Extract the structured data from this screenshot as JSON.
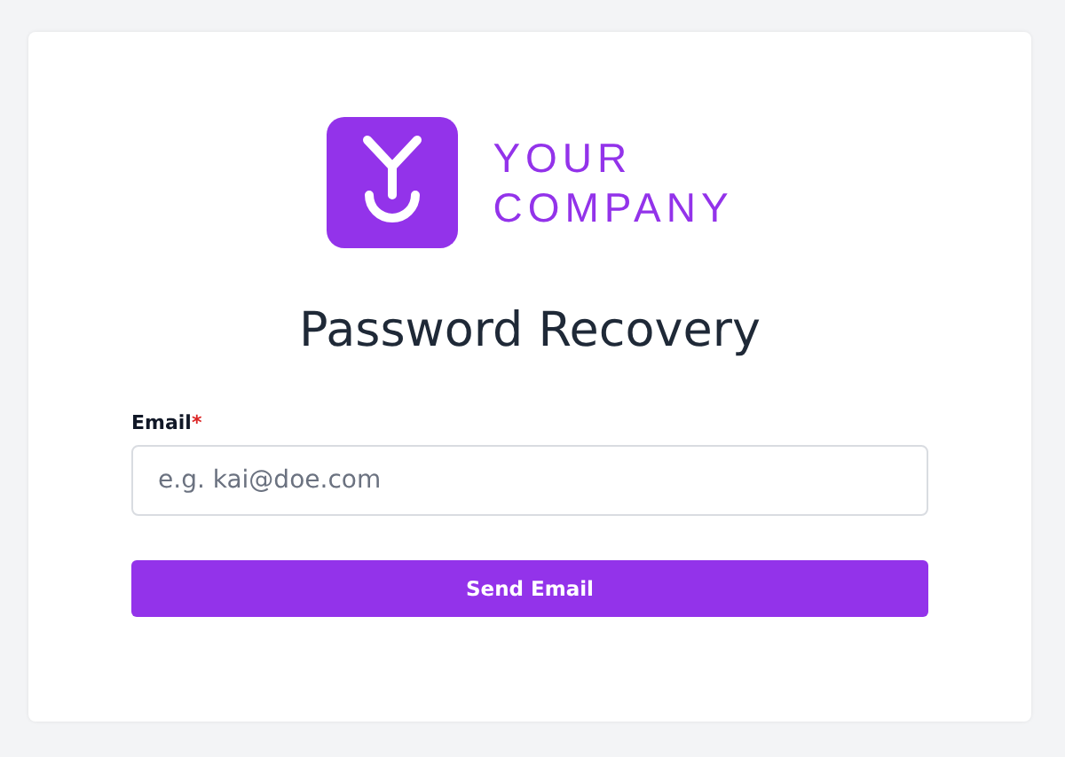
{
  "logo": {
    "lines": [
      "YOUR",
      "COMPANY"
    ]
  },
  "title": "Password Recovery",
  "email_field": {
    "label": "Email",
    "required_mark": "*",
    "placeholder": "e.g. kai@doe.com"
  },
  "submit_button": {
    "label": "Send Email"
  }
}
